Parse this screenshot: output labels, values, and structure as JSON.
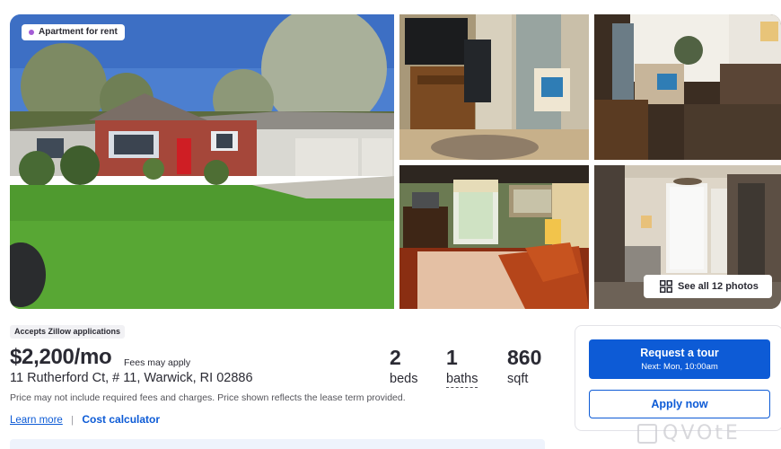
{
  "gallery": {
    "badge_label": "Apartment for rent",
    "see_all_label": "See all 12 photos"
  },
  "listing": {
    "zillow_badge": "Accepts Zillow applications",
    "price": "$2,200/mo",
    "fees_note": "Fees may apply",
    "address": "11 Rutherford Ct, # 11, Warwick, RI 02886",
    "disclaimer": "Price may not include required fees and charges. Price shown reflects the lease term provided.",
    "learn_more": "Learn more",
    "separator": "|",
    "cost_calculator": "Cost calculator"
  },
  "facts": {
    "beds_value": "2",
    "beds_label": "beds",
    "baths_value": "1",
    "baths_label": "baths",
    "sqft_value": "860",
    "sqft_label": "sqft"
  },
  "cta": {
    "tour_label": "Request a tour",
    "tour_sub": "Next: Mon, 10:00am",
    "apply_label": "Apply now"
  },
  "watermark": {
    "text": "QVOtE"
  },
  "colors": {
    "accent": "#0d5bd6",
    "badge_dot": "#a45cd6"
  },
  "icons": [
    "photo-grid-icon"
  ]
}
